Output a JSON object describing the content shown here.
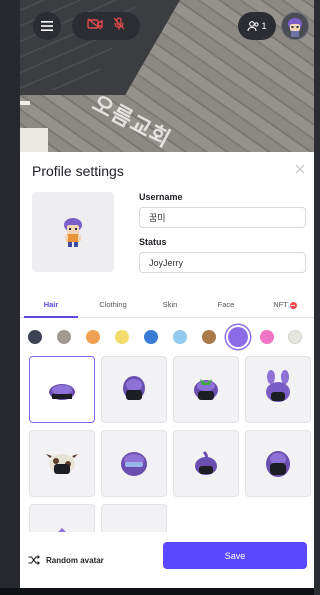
{
  "hud": {
    "people_count": "1",
    "map_text": "오름교회"
  },
  "profile": {
    "title": "Profile settings",
    "username_label": "Username",
    "username_value": "꿈미",
    "status_label": "Status",
    "status_value": "JoyJerry"
  },
  "tabs": [
    {
      "label": "Hair",
      "active": true
    },
    {
      "label": "Clothing",
      "active": false
    },
    {
      "label": "Skin",
      "active": false
    },
    {
      "label": "Face",
      "active": false
    },
    {
      "label": "NFT",
      "active": false
    }
  ],
  "colors": {
    "accent": "#5b49ff",
    "hair_swatches": [
      "#3d4352",
      "#a19a93",
      "#f0a152",
      "#f2dd6c",
      "#3a7bd5",
      "#92c9ee",
      "#a87a4a",
      "#8b6be8",
      "#ef74c4",
      "#e6e6e0"
    ],
    "selected_swatch": "#8b6be8"
  },
  "hair_options": [
    {
      "name": "hair-style-1",
      "selected": true
    },
    {
      "name": "hair-style-2",
      "selected": false
    },
    {
      "name": "hair-style-3",
      "selected": false
    },
    {
      "name": "hair-style-4",
      "selected": false
    },
    {
      "name": "hair-style-5",
      "selected": false
    },
    {
      "name": "hair-style-6",
      "selected": false
    },
    {
      "name": "hair-style-7",
      "selected": false
    },
    {
      "name": "hair-style-8",
      "selected": false
    },
    {
      "name": "hair-style-9",
      "selected": false
    },
    {
      "name": "hair-style-10",
      "selected": false
    }
  ],
  "footer": {
    "random_label": "Random avatar",
    "save_label": "Save"
  }
}
